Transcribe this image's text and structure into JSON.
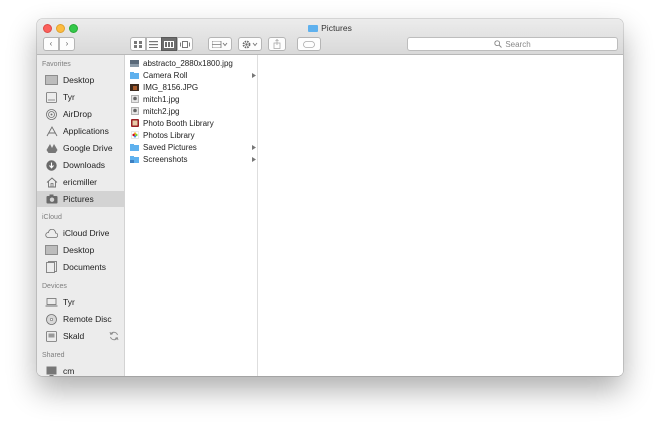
{
  "window": {
    "title": "Pictures"
  },
  "toolbar": {
    "back_glyph": "‹",
    "forward_glyph": "›",
    "view_modes": [
      "icon-view",
      "list-view",
      "column-view",
      "cover-flow-view"
    ],
    "active_view": "column-view",
    "arrange_icon": "arrange-icon",
    "action_icon": "gear-icon",
    "share_icon": "share-icon",
    "tags_icon": "tag-icon",
    "search_placeholder": "Search"
  },
  "sidebar": {
    "favorites_heading": "Favorites",
    "favorites": [
      {
        "label": "Desktop",
        "icon": "desktop-icon"
      },
      {
        "label": "Tyr",
        "icon": "disk-icon"
      },
      {
        "label": "AirDrop",
        "icon": "airdrop-icon"
      },
      {
        "label": "Applications",
        "icon": "applications-icon"
      },
      {
        "label": "Google Drive",
        "icon": "google-drive-icon"
      },
      {
        "label": "Downloads",
        "icon": "downloads-icon"
      },
      {
        "label": "ericmiller",
        "icon": "home-icon"
      },
      {
        "label": "Pictures",
        "icon": "camera-icon",
        "selected": true
      }
    ],
    "icloud_heading": "iCloud",
    "icloud": [
      {
        "label": "iCloud Drive",
        "icon": "cloud-icon"
      },
      {
        "label": "Desktop",
        "icon": "desktop-icon"
      },
      {
        "label": "Documents",
        "icon": "documents-icon"
      }
    ],
    "devices_heading": "Devices",
    "devices": [
      {
        "label": "Tyr",
        "icon": "laptop-icon"
      },
      {
        "label": "Remote Disc",
        "icon": "disc-icon"
      },
      {
        "label": "Skald",
        "icon": "drive-icon"
      }
    ],
    "shared_heading": "Shared",
    "shared": [
      {
        "label": "cm",
        "icon": "computer-icon"
      }
    ]
  },
  "files": [
    {
      "name": "abstracto_2880x1800.jpg",
      "icon": "image-icon",
      "folder": false
    },
    {
      "name": "Camera Roll",
      "icon": "folder-icon",
      "folder": true
    },
    {
      "name": "IMG_8156.JPG",
      "icon": "image-icon",
      "folder": false
    },
    {
      "name": "mitch1.jpg",
      "icon": "image-icon",
      "folder": false
    },
    {
      "name": "mitch2.jpg",
      "icon": "image-icon",
      "folder": false
    },
    {
      "name": "Photo Booth Library",
      "icon": "photo-booth-icon",
      "folder": false
    },
    {
      "name": "Photos Library",
      "icon": "photos-icon",
      "folder": false
    },
    {
      "name": "Saved Pictures",
      "icon": "folder-icon",
      "folder": true
    },
    {
      "name": "Screenshots",
      "icon": "folder-icon",
      "folder": true
    }
  ],
  "colors": {
    "folder": "#5fb1ee",
    "selection": "#d3d3d3",
    "close": "#fc605c",
    "minimize": "#fdbc40",
    "maximize": "#34c84a"
  }
}
